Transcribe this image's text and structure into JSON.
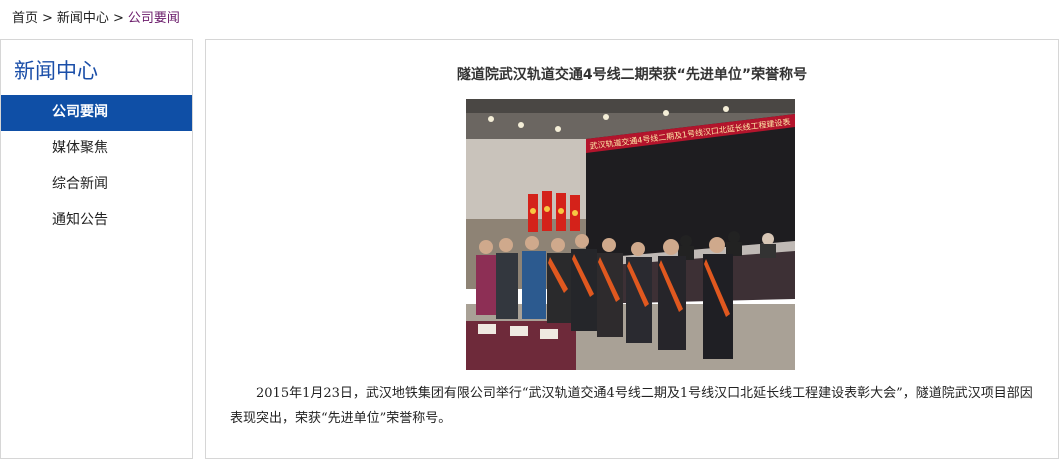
{
  "breadcrumb": {
    "home": "首页",
    "section": "新闻中心",
    "current": "公司要闻",
    "separator": ">"
  },
  "sidebar": {
    "title": "新闻中心",
    "items": [
      {
        "label": "公司要闻",
        "active": true
      },
      {
        "label": "媒体聚焦",
        "active": false
      },
      {
        "label": "综合新闻",
        "active": false
      },
      {
        "label": "通知公告",
        "active": false
      }
    ]
  },
  "article": {
    "title": "隧道院武汉轨道交通4号线二期荣获“先进单位”荣誉称号",
    "photo_banner": "武汉轨道交通4号线二期及1号线汉口北延长线工程建设表",
    "body": "2015年1月23日，武汉地铁集团有限公司举行“武汉轨道交通4号线二期及1号线汉口北延长线工程建设表彰大会”，隧道院武汉项目部因表现突出，荣获“先进单位”荣誉称号。"
  },
  "colors": {
    "accent": "#0f4fa6",
    "sidebar_title": "#1a4ea8",
    "breadcrumb_current": "#6a1a6a"
  }
}
